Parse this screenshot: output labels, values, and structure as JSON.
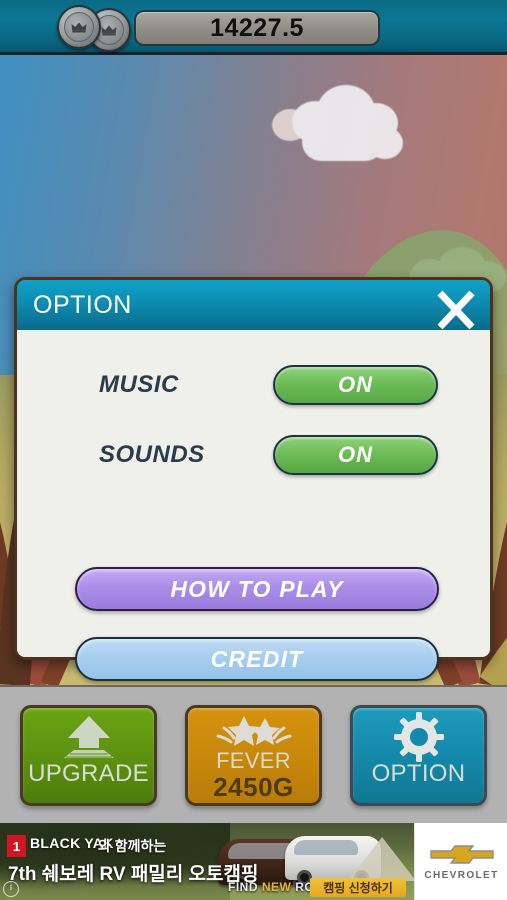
{
  "topbar": {
    "coin_icon": "crown-coin-icon",
    "score": "14227.5"
  },
  "dialog": {
    "title": "OPTION",
    "close_icon": "close-x-icon",
    "settings": [
      {
        "label": "MUSIC",
        "value": "ON"
      },
      {
        "label": "SOUNDS",
        "value": "ON"
      }
    ],
    "buttons": [
      {
        "label": "HOW TO PLAY",
        "color": "#ab8ee8"
      },
      {
        "label": "CREDIT",
        "color": "#a6cdef"
      }
    ]
  },
  "toolbar": {
    "buttons": [
      {
        "label": "UPGRADE",
        "sub": "",
        "icon": "up-arrow-icon",
        "color": "#5d9210"
      },
      {
        "label": "FEVER",
        "sub": "2450G",
        "icon": "star-burst-icon",
        "color": "#c8880b"
      },
      {
        "label": "OPTION",
        "sub": "",
        "icon": "gear-icon",
        "color": "#1589aa"
      }
    ]
  },
  "ad": {
    "badge": "1",
    "brand": "BLACK YAK",
    "line1": "와 함께하는",
    "line2": "7th 쉐보레 RV 패밀리 오토캠핑",
    "tagline_find": "FIND",
    "tagline_new": "NEW",
    "tagline_roads": "ROADS",
    "cta": "캠핑 신청하기",
    "logo_text": "CHEVROLET",
    "info_icon": "info-icon"
  }
}
